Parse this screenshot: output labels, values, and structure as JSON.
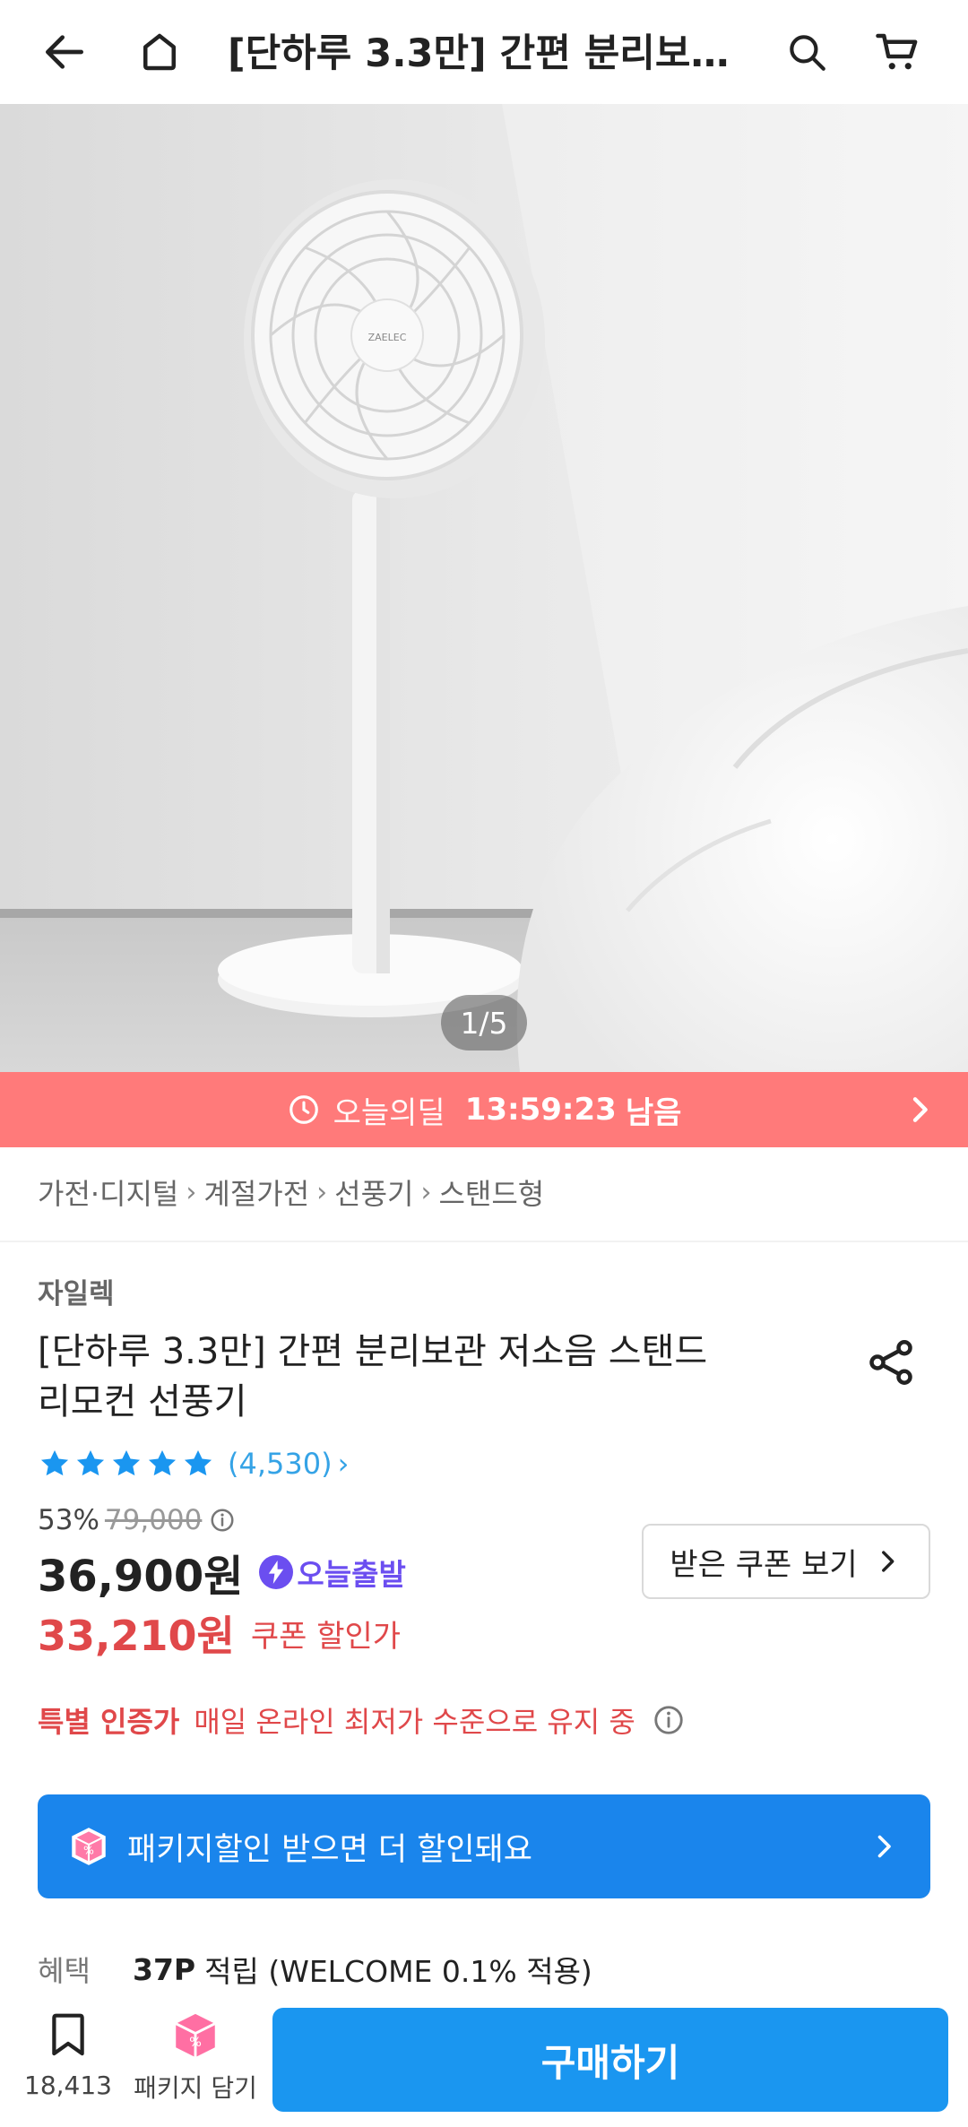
{
  "header": {
    "title": "[단하루 3.3만] 간편 분리보관 저소음 스탠드 리모컨 선풍기",
    "icons": [
      "back-arrow-icon",
      "home-icon",
      "search-icon",
      "cart-icon"
    ]
  },
  "gallery": {
    "pager": "1/5",
    "fan_logo": "ZAELEC"
  },
  "deal": {
    "label": "오늘의딜",
    "time": "13:59:23",
    "remaining": "남음"
  },
  "breadcrumb": [
    "가전·디지털",
    "계절가전",
    "선풍기",
    "스탠드형"
  ],
  "product": {
    "brand": "자일렉",
    "name_line1": "[단하루 3.3만] 간편 분리보관 저소음 스탠드",
    "name_line2": "리모컨 선풍기",
    "rating_count": "(4,530)",
    "stars": 5,
    "discount_rate": "53%",
    "original_price": "79,000",
    "price": "36,900원",
    "delivery_badge": "오늘출발",
    "coupon_button": "받은 쿠폰 보기",
    "coupon_price": "33,210원",
    "coupon_label": "쿠폰 할인가",
    "special_key": "특별 인증가",
    "special_text": "매일 온라인 최저가 수준으로 유지 중"
  },
  "package_banner": {
    "text": "패키지할인 받으면 더 할인돼요"
  },
  "benefit": {
    "label": "혜택",
    "points": "37P",
    "text": "적립 (WELCOME 0.1% 적용)"
  },
  "bottom_bar": {
    "bookmark_count": "18,413",
    "package_label": "패키지 담기",
    "buy_label": "구매하기"
  },
  "colors": {
    "deal_banner": "#ff7a7a",
    "accent_blue": "#1a96f0",
    "sale_red": "#e0484a",
    "rating_blue": "#35a3e6",
    "badge_purple": "#6b4ef0"
  }
}
